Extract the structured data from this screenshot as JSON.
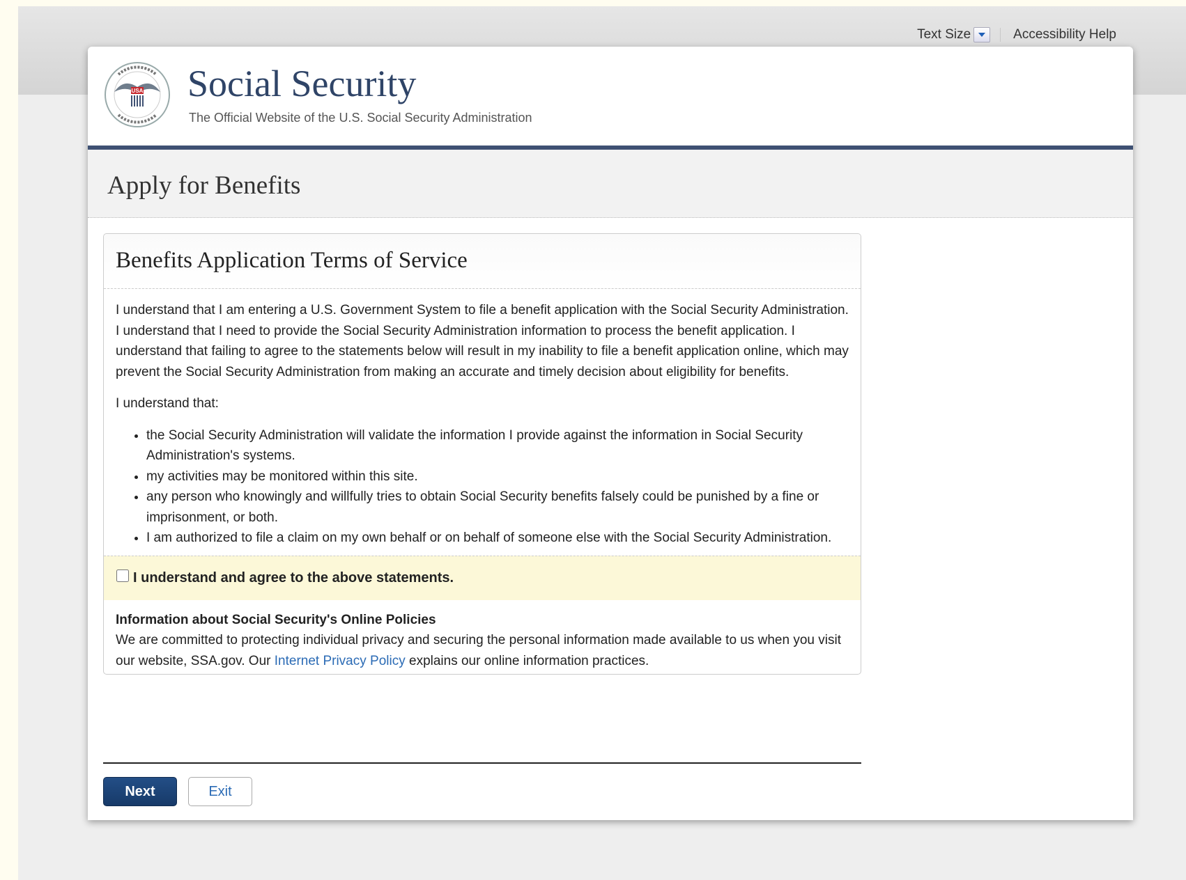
{
  "utility_bar": {
    "text_size_label": "Text Size",
    "accessibility_label": "Accessibility Help"
  },
  "header": {
    "brand_title": "Social Security",
    "brand_subtitle": "The Official Website of the U.S. Social Security Administration",
    "seal_text": "SOCIAL SECURITY ADMINISTRATION USA",
    "seal_icon": "ssa-seal-logo"
  },
  "page": {
    "title": "Apply for Benefits"
  },
  "panel": {
    "title": "Benefits Application Terms of Service",
    "intro": "I understand that I am entering a U.S. Government System to file a benefit application with the Social Security Administration. I understand that I need to provide the Social Security Administration information to process the benefit application. I understand that failing to agree to the statements below will result in my inability to file a benefit application online, which may prevent the Social Security Administration from making an accurate and timely decision about eligibility for benefits.",
    "understand_label": "I understand that:",
    "items": [
      "the Social Security Administration will validate the information I provide against the information in Social Security Administration's systems.",
      "my activities may be monitored within this site.",
      "any person who knowingly and willfully tries to obtain Social Security benefits falsely could be punished by a fine or imprisonment, or both.",
      "I am authorized to file a claim on my own behalf or on behalf of someone else with the Social Security Administration."
    ],
    "agree_label": "I understand and agree to the above statements.",
    "agree_checked": false,
    "policies_heading": "Information about Social Security's Online Policies",
    "policies_text_before": "We are committed to protecting individual privacy and securing the personal information made available to us when you visit our website, SSA.gov. Our ",
    "policies_link": "Internet Privacy Policy",
    "policies_text_after": " explains our online information practices."
  },
  "buttons": {
    "next": "Next",
    "exit": "Exit"
  },
  "colors": {
    "brand": "#2f4467",
    "header_rule": "#3f5173",
    "link": "#2b6bb5",
    "agree_bg": "#fcf8d8",
    "next_bg": "#1d4478"
  }
}
